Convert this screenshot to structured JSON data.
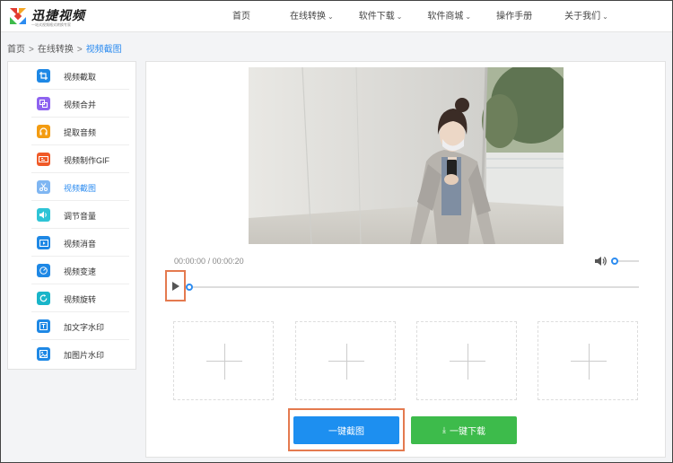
{
  "brand": {
    "name": "迅捷视频",
    "tagline": "一站式视频格式转换专家",
    "colors": [
      "#e23b30",
      "#f5a623",
      "#3dbb4b",
      "#2d8cf0"
    ]
  },
  "nav": {
    "items": [
      {
        "label": "首页",
        "dropdown": false
      },
      {
        "label": "在线转换",
        "dropdown": true
      },
      {
        "label": "软件下载",
        "dropdown": true
      },
      {
        "label": "软件商城",
        "dropdown": true
      },
      {
        "label": "操作手册",
        "dropdown": false
      },
      {
        "label": "关于我们",
        "dropdown": true
      }
    ],
    "chevron_icon": "chevron-down-icon"
  },
  "breadcrumb": {
    "home": "首页",
    "section": "在线转换",
    "current": "视频截图",
    "separator": ">"
  },
  "sidebar": {
    "active_index": 4,
    "items": [
      {
        "label": "视频截取",
        "icon": "crop-icon",
        "color": "#1e88e5"
      },
      {
        "label": "视频合并",
        "icon": "merge-icon",
        "color": "#8e63f0"
      },
      {
        "label": "提取音频",
        "icon": "headphones-icon",
        "color": "#f39c12"
      },
      {
        "label": "视频制作GIF",
        "icon": "gif-icon",
        "color": "#f05a28"
      },
      {
        "label": "视频截图",
        "icon": "scissors-icon",
        "color": "#7fb6f2"
      },
      {
        "label": "调节音量",
        "icon": "volume-icon",
        "color": "#2ec4d6"
      },
      {
        "label": "视频消音",
        "icon": "mute-video-icon",
        "color": "#1e88e5"
      },
      {
        "label": "视频变速",
        "icon": "speedometer-icon",
        "color": "#1e88e5"
      },
      {
        "label": "视频旋转",
        "icon": "rotate-icon",
        "color": "#19b5c9"
      },
      {
        "label": "加文字水印",
        "icon": "text-watermark-icon",
        "color": "#1e88e5"
      },
      {
        "label": "加图片水印",
        "icon": "image-watermark-icon",
        "color": "#1e88e5"
      }
    ]
  },
  "player": {
    "current_time": "00:00:00",
    "separator": "/",
    "duration": "00:00:20",
    "progress": 0,
    "volume_level": 0
  },
  "screenshot_slots": 4,
  "actions": {
    "capture_label": "一键截图",
    "download_label": "一键下载",
    "download_icon": "download-icon",
    "capture_color": "#1d8ff0",
    "download_color": "#3dbb4b"
  },
  "highlight_color": "#e47a4f"
}
